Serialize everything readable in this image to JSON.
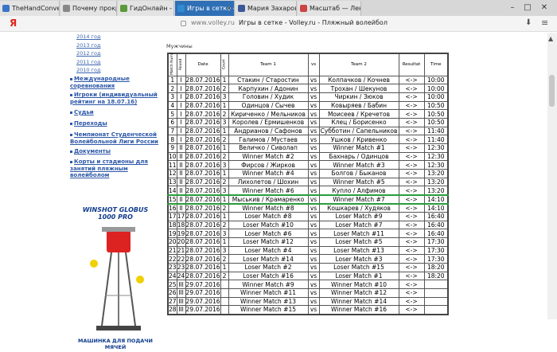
{
  "browser": {
    "tabs": [
      {
        "label": "TheHandConverter.co",
        "fav_color": "#3a74c6"
      },
      {
        "label": "Почему прокрастина",
        "fav_color": "#888888"
      },
      {
        "label": "ГидОнлайн - Твой гид",
        "fav_color": "#5a9a3a"
      },
      {
        "label": "Игры в сетке - Voll",
        "fav_color": "#2f8cd1"
      },
      {
        "label": "Мария Захарова - Ещ",
        "fav_color": "#3b5998"
      },
      {
        "label": "Масштаб — Лени",
        "fav_color": "#cc4444"
      }
    ],
    "logo": "Я",
    "url_domain": "www.volley.ru",
    "url_title": "Игры в сетке - Volley.ru - Пляжный волейбол"
  },
  "sidebar": {
    "years": [
      "2014 год",
      "2013 год",
      "2012 год",
      "2011 год",
      "2010 год"
    ],
    "nav": [
      "Международные соревнования",
      "Игроки (индивидуальный рейтинг на 18.07.16)",
      "Судьи",
      "Переходы",
      "Чемпионат Студенческой Волейбольной Лиги России",
      "Документы",
      "Корты и стадионы для занятий пляжным волейболом"
    ],
    "ad_title": "WINSHOT GLOBUS 1000 PRO",
    "ad_caption": "МАШИНКА ДЛЯ ПОДАЧИ МЯЧЕЙ"
  },
  "main": {
    "section_label": "Мужчины",
    "headers": [
      "Match Number",
      "Round",
      "Date",
      "Court",
      "Team 1",
      "vs",
      "Team 2",
      "Resultat",
      "Time"
    ],
    "highlight_color": "#2a9c3a",
    "rows": [
      [
        "1",
        "I",
        "28.07.2016",
        "1",
        "Стакин / Старостин",
        "vs",
        "Колпачков / Кочнев",
        "<->",
        "10:00"
      ],
      [
        "2",
        "I",
        "28.07.2016",
        "2",
        "Карпухин / Адонин",
        "vs",
        "Трохан / Шекунов",
        "<->",
        "10:00"
      ],
      [
        "3",
        "I",
        "28.07.2016",
        "3",
        "Головин / Худик",
        "vs",
        "Чиркин / Зюков",
        "<->",
        "10:00"
      ],
      [
        "4",
        "I",
        "28.07.2016",
        "1",
        "Одинцов / Сычев",
        "vs",
        "Ковыряев / Бабин",
        "<->",
        "10:50"
      ],
      [
        "5",
        "I",
        "28.07.2016",
        "2",
        "Кириченко / Мельников",
        "vs",
        "Моисеев / Кречетов",
        "<->",
        "10:50"
      ],
      [
        "6",
        "I",
        "28.07.2016",
        "3",
        "Королев / Ермишенков",
        "vs",
        "Клец / Борисенко",
        "<->",
        "10:50"
      ],
      [
        "7",
        "I",
        "28.07.2016",
        "1",
        "Андрианов / Сафонов",
        "vs",
        "Субботин / Сапельников",
        "<->",
        "11:40"
      ],
      [
        "8",
        "I",
        "28.07.2016",
        "2",
        "Галимов / Мустаев",
        "vs",
        "Ушков / Кривенко",
        "<->",
        "11:40"
      ],
      [
        "9",
        "II",
        "28.07.2016",
        "1",
        "Величко / Сиволап",
        "vs",
        "Winner Match #1",
        "<->",
        "12:30"
      ],
      [
        "10",
        "II",
        "28.07.2016",
        "2",
        "Winner Match #2",
        "vs",
        "Бахнарь / Одинцов",
        "<->",
        "12:30"
      ],
      [
        "11",
        "II",
        "28.07.2016",
        "3",
        "Фирсов / Жирков",
        "vs",
        "Winner Match #3",
        "<->",
        "12:30"
      ],
      [
        "12",
        "II",
        "28.07.2016",
        "1",
        "Winner Match #4",
        "vs",
        "Болгов / Быканов",
        "<->",
        "13:20"
      ],
      [
        "13",
        "II",
        "28.07.2016",
        "2",
        "Лихолетов / Шохин",
        "vs",
        "Winner Match #5",
        "<->",
        "13:20"
      ],
      [
        "14",
        "II",
        "28.07.2016",
        "3",
        "Winner Match #6",
        "vs",
        "Купло / Алфимов",
        "<->",
        "13:20"
      ],
      [
        "15",
        "II",
        "28.07.2016",
        "1",
        "Мыськив / Крамаренко",
        "vs",
        "Winner Match #7",
        "<->",
        "14:10"
      ],
      [
        "16",
        "II",
        "28.07.2016",
        "2",
        "Winner Match #8",
        "vs",
        "Кошкарев / Худяков",
        "<->",
        "14:10"
      ],
      [
        "17",
        "17",
        "28.07.2016",
        "1",
        "Loser Match #8",
        "vs",
        "Loser Match #9",
        "<->",
        "16:40"
      ],
      [
        "18",
        "18",
        "28.07.2016",
        "2",
        "Loser Match #10",
        "vs",
        "Loser Match #7",
        "<->",
        "16:40"
      ],
      [
        "19",
        "19",
        "28.07.2016",
        "3",
        "Loser Match #6",
        "vs",
        "Loser Match #11",
        "<->",
        "16:40"
      ],
      [
        "20",
        "20",
        "28.07.2016",
        "1",
        "Loser Match #12",
        "vs",
        "Loser Match #5",
        "<->",
        "17:30"
      ],
      [
        "21",
        "21",
        "28.07.2016",
        "3",
        "Loser Match #4",
        "vs",
        "Loser Match #13",
        "<->",
        "17:30"
      ],
      [
        "22",
        "22",
        "28.07.2016",
        "2",
        "Loser Match #14",
        "vs",
        "Loser Match #3",
        "<->",
        "17:30"
      ],
      [
        "23",
        "23",
        "28.07.2016",
        "1",
        "Loser Match #2",
        "vs",
        "Loser Match #15",
        "<->",
        "18:20"
      ],
      [
        "24",
        "24",
        "28.07.2016",
        "2",
        "Loser Match #16",
        "vs",
        "Loser Match #1",
        "<->",
        "18:20"
      ],
      [
        "25",
        "III",
        "29.07.2016",
        "",
        "Winner Match #9",
        "vs",
        "Winner Match #10",
        "<->",
        ""
      ],
      [
        "26",
        "III",
        "29.07.2016",
        "",
        "Winner Match #11",
        "vs",
        "Winner Match #12",
        "<->",
        ""
      ],
      [
        "27",
        "III",
        "29.07.2016",
        "",
        "Winner Match #13",
        "vs",
        "Winner Match #14",
        "<->",
        ""
      ],
      [
        "28",
        "III",
        "29.07.2016",
        "",
        "Winner Match #15",
        "vs",
        "Winner Match #16",
        "<->",
        ""
      ]
    ],
    "highlight_row": 14
  }
}
